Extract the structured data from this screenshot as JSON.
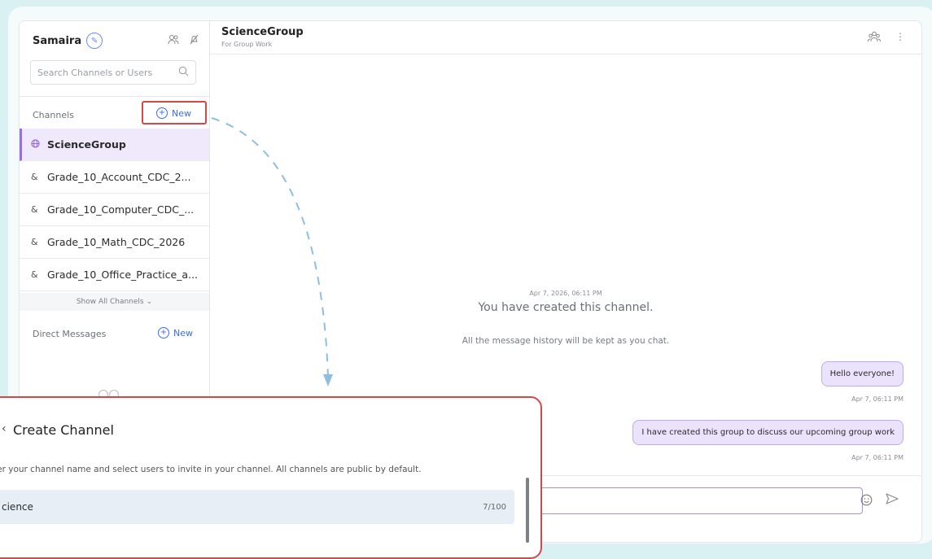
{
  "sidebar": {
    "user_name": "Samaira",
    "search_placeholder": "Search Channels or Users",
    "channels_title": "Channels",
    "channels_new_label": "New",
    "channels": [
      {
        "label": "ScienceGroup",
        "icon": "globe-icon",
        "active": true
      },
      {
        "label": "Grade_10_Account_CDC_2...",
        "icon": "group-icon",
        "active": false
      },
      {
        "label": "Grade_10_Computer_CDC_...",
        "icon": "group-icon",
        "active": false
      },
      {
        "label": "Grade_10_Math_CDC_2026",
        "icon": "group-icon",
        "active": false
      },
      {
        "label": "Grade_10_Office_Practice_a...",
        "icon": "group-icon",
        "active": false
      }
    ],
    "show_all": "Show All Channels",
    "dm_title": "Direct Messages",
    "dm_new_label": "New"
  },
  "header": {
    "channel_name": "ScienceGroup",
    "channel_subtitle": "For Group Work"
  },
  "chat": {
    "created_timestamp": "Apr 7, 2026, 06:11 PM",
    "created_text": "You have created this channel.",
    "history_text": "All the message history will be kept as you chat.",
    "messages": [
      {
        "text": "Hello everyone!",
        "time": "Apr 7, 06:11 PM"
      },
      {
        "text": "I have created this group to discuss our upcoming group work",
        "time": "Apr 7, 06:11 PM"
      }
    ]
  },
  "dialog": {
    "title": "Create Channel",
    "description": "ter your channel name and select users to invite in your channel. All channels are public by default.",
    "name_value": "cience",
    "char_count": "7/100"
  },
  "colors": {
    "accent_purple": "#9c6fe0",
    "highlight_red": "#d6474a",
    "link_blue": "#3a6cf0",
    "arrow_blue": "#8fbfe0"
  }
}
